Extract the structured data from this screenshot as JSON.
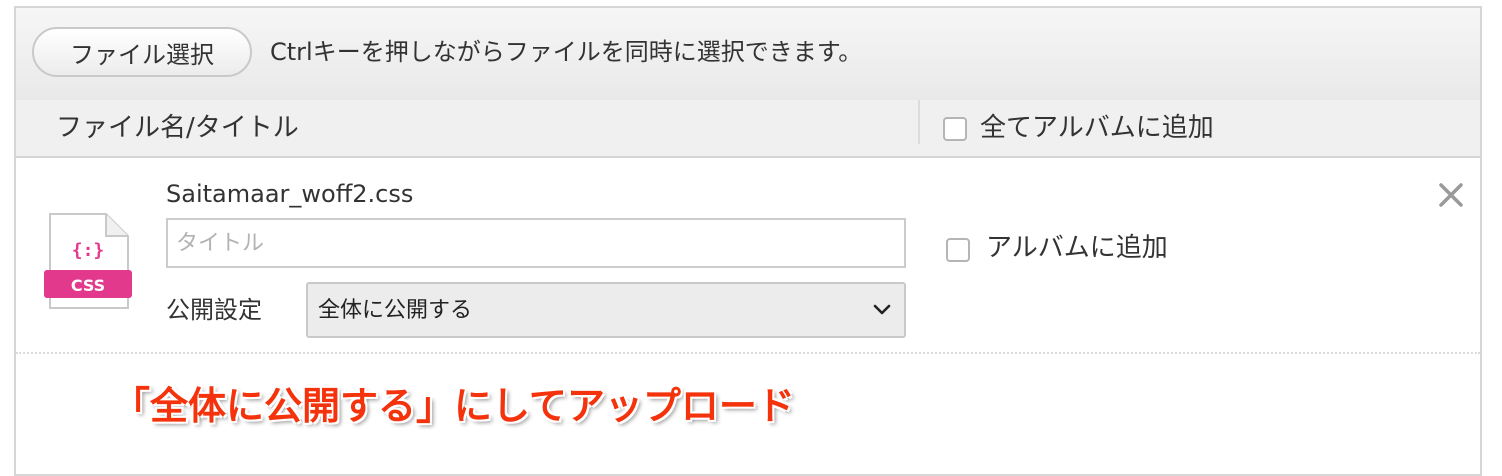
{
  "toolbar": {
    "file_select_label": "ファイル選択",
    "hint": "Ctrlキーを押しながらファイルを同時に選択できます。"
  },
  "table_header": {
    "name_title_column": "ファイル名/タイトル",
    "add_all_to_album_label": "全てアルバムに追加",
    "add_all_to_album_checked": false
  },
  "file_item": {
    "icon": "css-file-icon",
    "icon_badge": "CSS",
    "icon_glyph": "{:}",
    "file_name": "Saitamaar_woff2.css",
    "title_value": "",
    "title_placeholder": "タイトル",
    "visibility_label": "公開設定",
    "visibility_value": "全体に公開する",
    "add_to_album_label": "アルバムに追加",
    "add_to_album_checked": false,
    "remove_icon": "close-icon"
  },
  "annotation": {
    "text": "「全体に公開する」にしてアップロード",
    "color": "#f4320c"
  },
  "colors": {
    "css_badge": "#e3398c",
    "border": "#d6d6d6"
  }
}
